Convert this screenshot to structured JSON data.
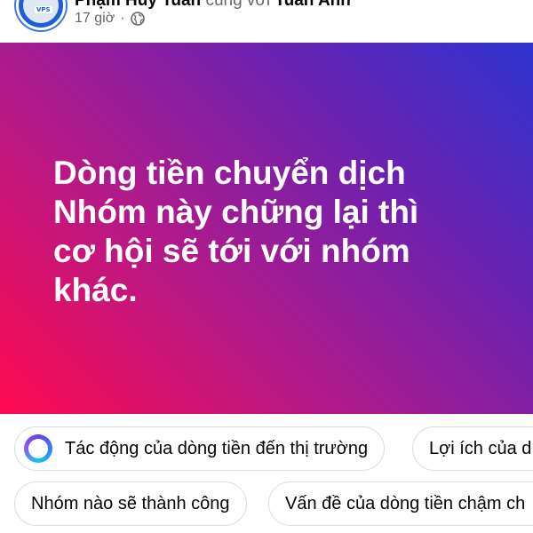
{
  "post": {
    "author": "Phạm Huy Tuấn",
    "with_text": "cùng với",
    "tagged": "Tuấn Anh",
    "time": "17 giờ",
    "audience_icon": "globe-icon",
    "avatar_badge": "VPS",
    "text_lines": [
      "Dòng tiền chuyển dịch",
      "Nhóm này chững lại thì",
      "cơ hội sẽ tới với nhóm",
      "khác."
    ],
    "gradient_colors": [
      "#ff0a4f",
      "#b01a8b",
      "#6a22b0",
      "#2e33cf"
    ]
  },
  "suggestions": {
    "icon": "meta-ai-ring-icon",
    "row1": [
      "Tác động của dòng tiền đến thị trường",
      "Lợi ích của d"
    ],
    "row2": [
      "Nhóm nào sẽ thành công",
      "Vấn đề của dòng tiền chậm ch"
    ]
  }
}
